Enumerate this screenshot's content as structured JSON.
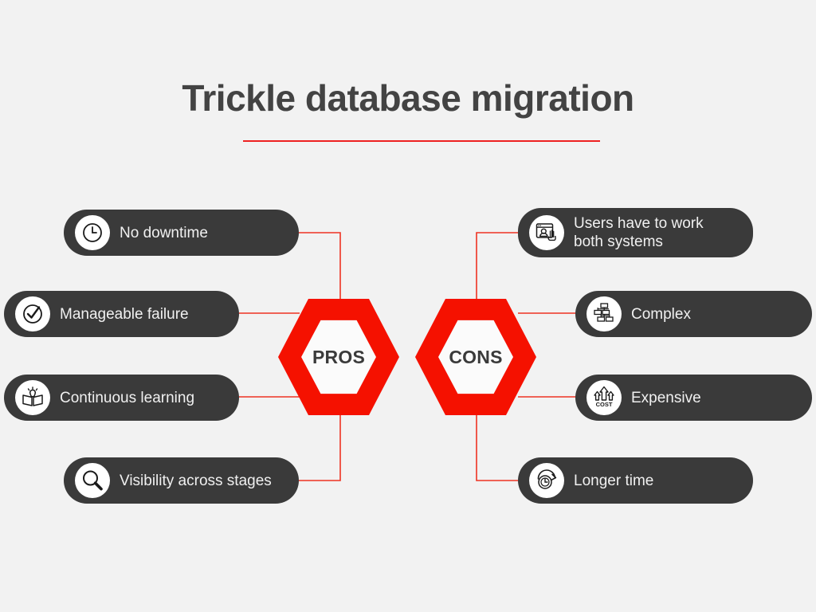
{
  "header": {
    "title": "Trickle database migration",
    "rule_color": "#ee2222"
  },
  "colors": {
    "background": "#f2f2f2",
    "pill_background": "#3a3a3a",
    "pill_text": "#f0f0f0",
    "hex_red": "#f51100",
    "hex_inner": "#fbfbfb",
    "hex_text": "#3a3a3a",
    "connector_red": "#ee3322",
    "title_text": "#434343"
  },
  "hubs": {
    "pros": {
      "label": "PROS"
    },
    "cons": {
      "label": "CONS"
    }
  },
  "pros": {
    "items": [
      {
        "label": "No downtime",
        "icon": "clock-icon"
      },
      {
        "label": "Manageable failure",
        "icon": "check-circle-icon"
      },
      {
        "label": "Continuous learning",
        "icon": "book-lightbulb-icon"
      },
      {
        "label": "Visibility across stages",
        "icon": "magnifier-icon"
      }
    ]
  },
  "cons": {
    "items": [
      {
        "label": "Users have to work\nboth systems",
        "icon": "user-window-icon"
      },
      {
        "label": "Complex",
        "icon": "network-nodes-icon"
      },
      {
        "label": "Expensive",
        "icon": "cost-arrows-icon"
      },
      {
        "label": "Longer time",
        "icon": "clock-arrow-icon"
      }
    ]
  }
}
